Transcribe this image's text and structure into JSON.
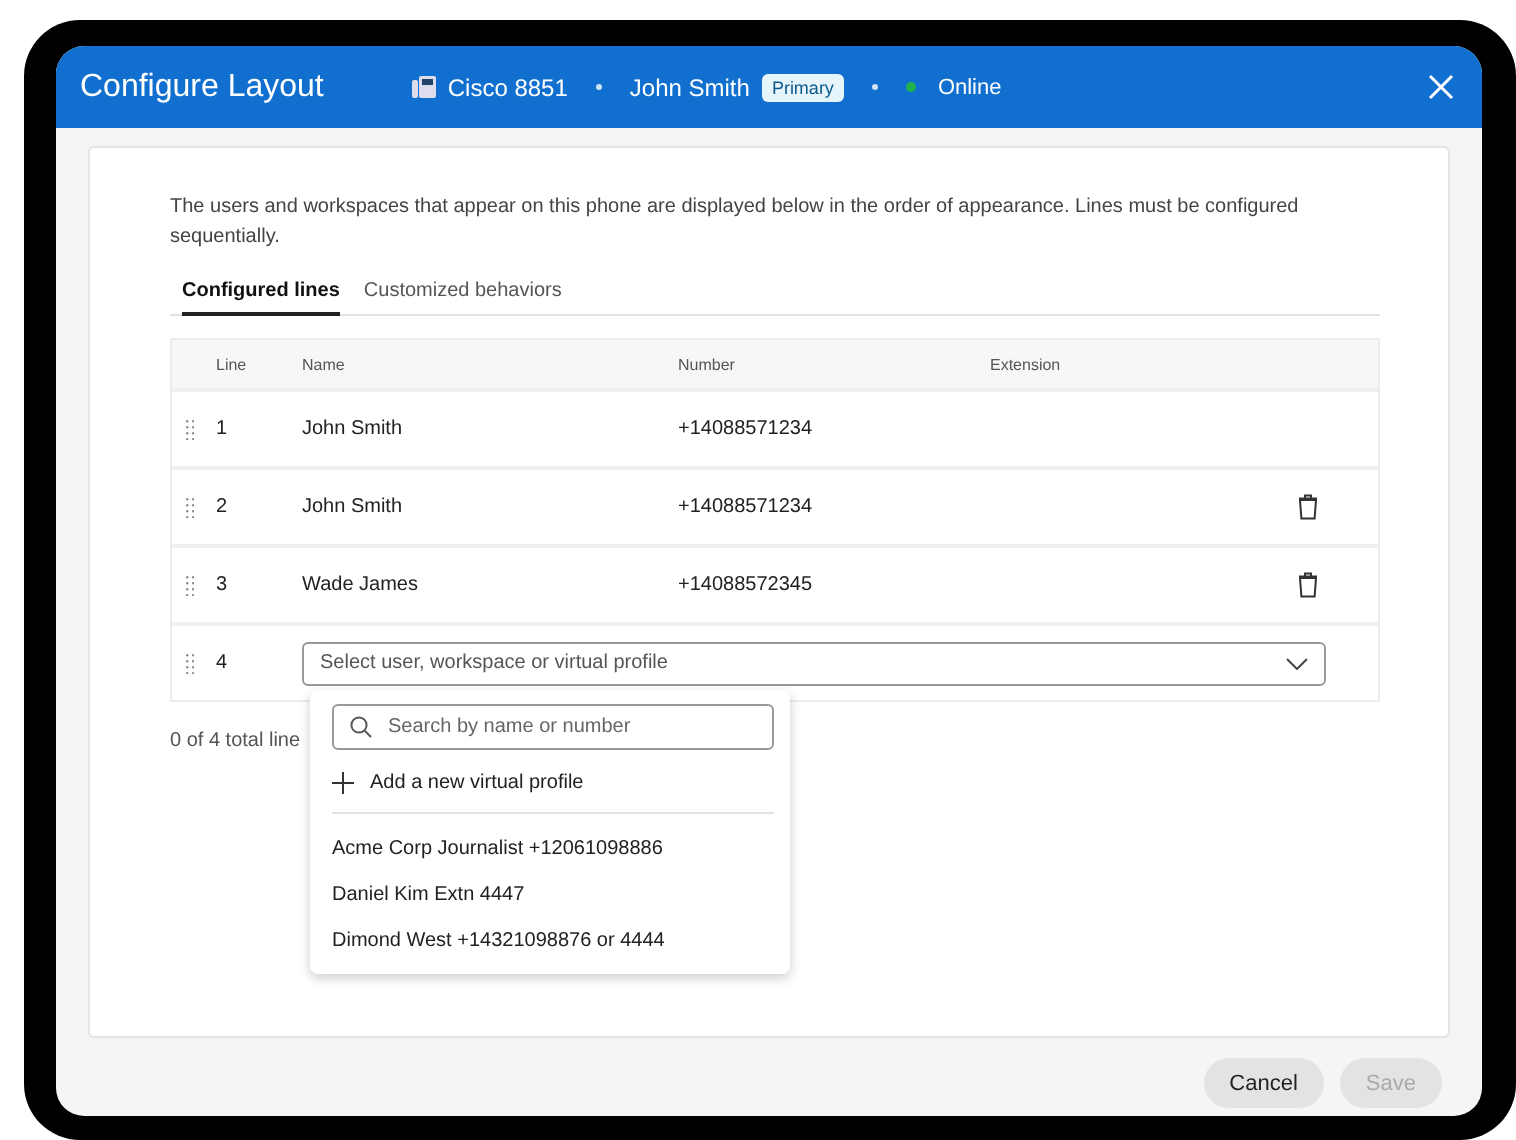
{
  "window": {
    "title": "Configure Layout"
  },
  "header": {
    "device": "Cisco 8851",
    "user": "John Smith",
    "user_badge": "Primary",
    "status": {
      "label": "Online",
      "color": "#22b14c"
    }
  },
  "description": "The users and workspaces that appear on this phone are displayed below in the order of appearance. Lines must be configured sequentially.",
  "tabs": [
    {
      "label": "Configured lines",
      "selected": true
    },
    {
      "label": "Customized behaviors",
      "selected": false
    }
  ],
  "table": {
    "columns": [
      "Line",
      "Name",
      "Number",
      "Extension"
    ],
    "rows": [
      {
        "kind": "line",
        "line": "1",
        "name": "John Smith",
        "number": "+14088571234",
        "deletable": false
      },
      {
        "kind": "line",
        "line": "2",
        "name": "John Smith",
        "number": "+14088571234",
        "deletable": true
      },
      {
        "kind": "line",
        "line": "3",
        "name": "Wade James",
        "number": "+14088572345",
        "deletable": true
      },
      {
        "kind": "select",
        "line": "4",
        "placeholder": "Select user, workspace or virtual profile"
      }
    ]
  },
  "total": "0 of 4 total line",
  "dropdown": {
    "search_placeholder": "Search by name or number",
    "add_label": "Add a new virtual profile",
    "options": [
      "Acme Corp Journalist +12061098886",
      "Daniel Kim Extn 4447",
      "Dimond West +14321098876 or 4444"
    ]
  },
  "buttons": [
    {
      "label": "Cancel",
      "disabled": false
    },
    {
      "label": "Save",
      "disabled": true
    }
  ]
}
